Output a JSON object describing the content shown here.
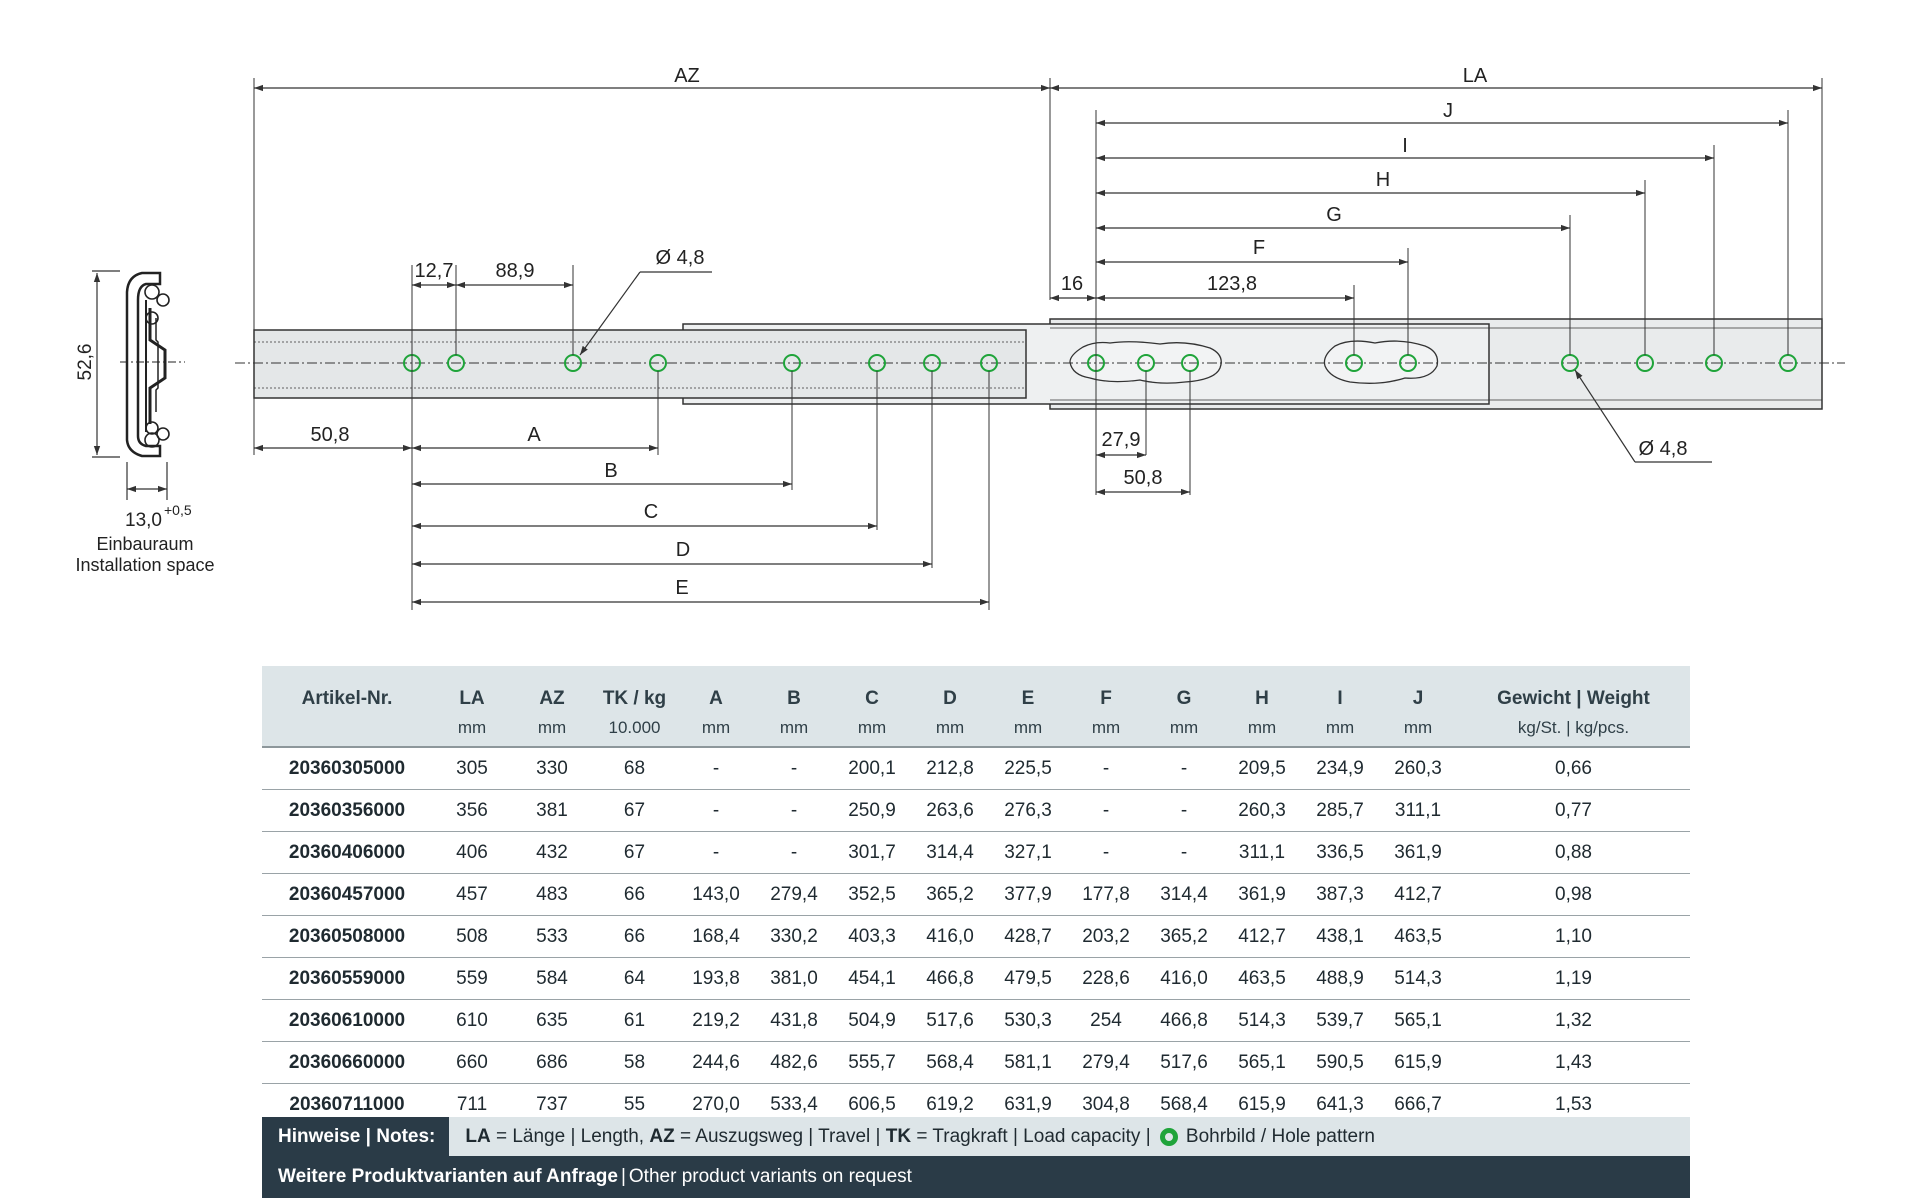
{
  "drawing": {
    "dims": {
      "az": "AZ",
      "la": "LA",
      "j": "J",
      "i": "I",
      "h": "H",
      "g": "G",
      "f": "F",
      "d16": "16",
      "d123_8": "123,8",
      "d12_7": "12,7",
      "d88_9": "88,9",
      "hole_left": "Ø 4,8",
      "hole_right": "Ø 4,8",
      "d50_8_left": "50,8",
      "a": "A",
      "b": "B",
      "c": "C",
      "d": "D",
      "e": "E",
      "d27_9": "27,9",
      "d50_8_right": "50,8",
      "height": "52,6",
      "width_base": "13,0",
      "width_tol": "+0,5",
      "install_de": "Einbauraum",
      "install_en": "Installation space"
    },
    "colors": {
      "hole": "#1fa43a",
      "line": "#333333",
      "rail": "#e8eaeb"
    }
  },
  "table": {
    "header_top": [
      "Artikel-Nr.",
      "LA",
      "AZ",
      "TK / kg",
      "A",
      "B",
      "C",
      "D",
      "E",
      "F",
      "G",
      "H",
      "I",
      "J",
      "Gewicht | Weight"
    ],
    "header_units": [
      "",
      "mm",
      "mm",
      "10.000",
      "mm",
      "mm",
      "mm",
      "mm",
      "mm",
      "mm",
      "mm",
      "mm",
      "mm",
      "mm",
      "kg/St. | kg/pcs."
    ],
    "rows": [
      [
        "20360305000",
        "305",
        "330",
        "68",
        "-",
        "-",
        "200,1",
        "212,8",
        "225,5",
        "-",
        "-",
        "209,5",
        "234,9",
        "260,3",
        "0,66"
      ],
      [
        "20360356000",
        "356",
        "381",
        "67",
        "-",
        "-",
        "250,9",
        "263,6",
        "276,3",
        "-",
        "-",
        "260,3",
        "285,7",
        "311,1",
        "0,77"
      ],
      [
        "20360406000",
        "406",
        "432",
        "67",
        "-",
        "-",
        "301,7",
        "314,4",
        "327,1",
        "-",
        "-",
        "311,1",
        "336,5",
        "361,9",
        "0,88"
      ],
      [
        "20360457000",
        "457",
        "483",
        "66",
        "143,0",
        "279,4",
        "352,5",
        "365,2",
        "377,9",
        "177,8",
        "314,4",
        "361,9",
        "387,3",
        "412,7",
        "0,98"
      ],
      [
        "20360508000",
        "508",
        "533",
        "66",
        "168,4",
        "330,2",
        "403,3",
        "416,0",
        "428,7",
        "203,2",
        "365,2",
        "412,7",
        "438,1",
        "463,5",
        "1,10"
      ],
      [
        "20360559000",
        "559",
        "584",
        "64",
        "193,8",
        "381,0",
        "454,1",
        "466,8",
        "479,5",
        "228,6",
        "416,0",
        "463,5",
        "488,9",
        "514,3",
        "1,19"
      ],
      [
        "20360610000",
        "610",
        "635",
        "61",
        "219,2",
        "431,8",
        "504,9",
        "517,6",
        "530,3",
        "254",
        "466,8",
        "514,3",
        "539,7",
        "565,1",
        "1,32"
      ],
      [
        "20360660000",
        "660",
        "686",
        "58",
        "244,6",
        "482,6",
        "555,7",
        "568,4",
        "581,1",
        "279,4",
        "517,6",
        "565,1",
        "590,5",
        "615,9",
        "1,43"
      ],
      [
        "20360711000",
        "711",
        "737",
        "55",
        "270,0",
        "533,4",
        "606,5",
        "619,2",
        "631,9",
        "304,8",
        "568,4",
        "615,9",
        "641,3",
        "666,7",
        "1,53"
      ]
    ]
  },
  "notes": {
    "title": "Hinweise | Notes:",
    "la_key": "LA",
    "la_text": " = Länge | Length, ",
    "az_key": "AZ",
    "az_text": " = Auszugsweg | Travel | ",
    "tk_key": "TK",
    "tk_text": " = Tragkraft | Load capacity | ",
    "hole_icon": "hole-pattern-ring-icon",
    "hole_text": "Bohrbild / Hole pattern"
  },
  "variants": {
    "bold": "Weitere Produktvarianten auf Anfrage",
    "separator": "|",
    "rest": "Other product variants on request"
  }
}
